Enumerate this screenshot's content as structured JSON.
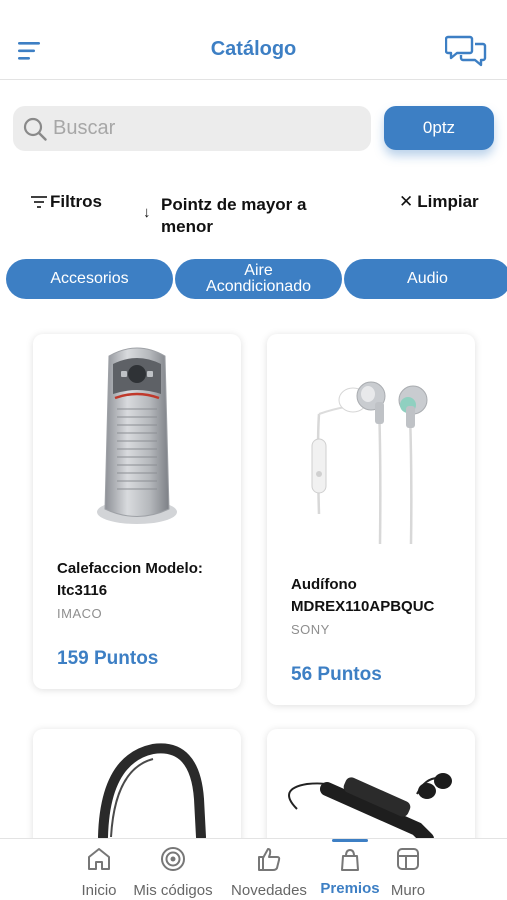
{
  "header": {
    "title": "Catálogo"
  },
  "search": {
    "placeholder": "Buscar",
    "value": "",
    "points_button": "0ptz"
  },
  "toolbar": {
    "filters_label": "Filtros",
    "sort_label": "Pointz de mayor a menor",
    "clear_label": "Limpiar"
  },
  "categories": [
    "Accesorios",
    "Aire Acondicionado",
    "Audio"
  ],
  "products": [
    {
      "name": "Calefaccion Modelo: Itc3116",
      "brand": "IMACO",
      "points": "159 Puntos"
    },
    {
      "name": "Audífono MDREX110APBQUC",
      "brand": "SONY",
      "points": "56 Puntos"
    }
  ],
  "nav": {
    "items": [
      {
        "label": "Inicio",
        "icon": "home-icon"
      },
      {
        "label": "Mis códigos",
        "icon": "target-icon"
      },
      {
        "label": "Novedades",
        "icon": "thumbs-up-icon"
      },
      {
        "label": "Premios",
        "icon": "bag-icon"
      },
      {
        "label": "Muro",
        "icon": "layout-icon"
      }
    ],
    "active": "Premios"
  },
  "colors": {
    "accent": "#3d7fc4",
    "search_bg": "#ececec",
    "muted": "#8e8e8e"
  }
}
